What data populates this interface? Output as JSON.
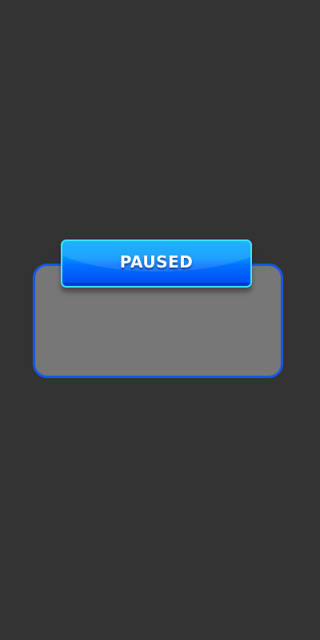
{
  "pause_menu": {
    "title": "PAUSED"
  },
  "colors": {
    "background": "#333333",
    "panel_fill": "#777777",
    "panel_border": "#1557e8",
    "banner_top": "#00a8ff",
    "banner_bottom": "#0048f0",
    "banner_border": "#39e6ff",
    "title_text": "#ffffff"
  }
}
